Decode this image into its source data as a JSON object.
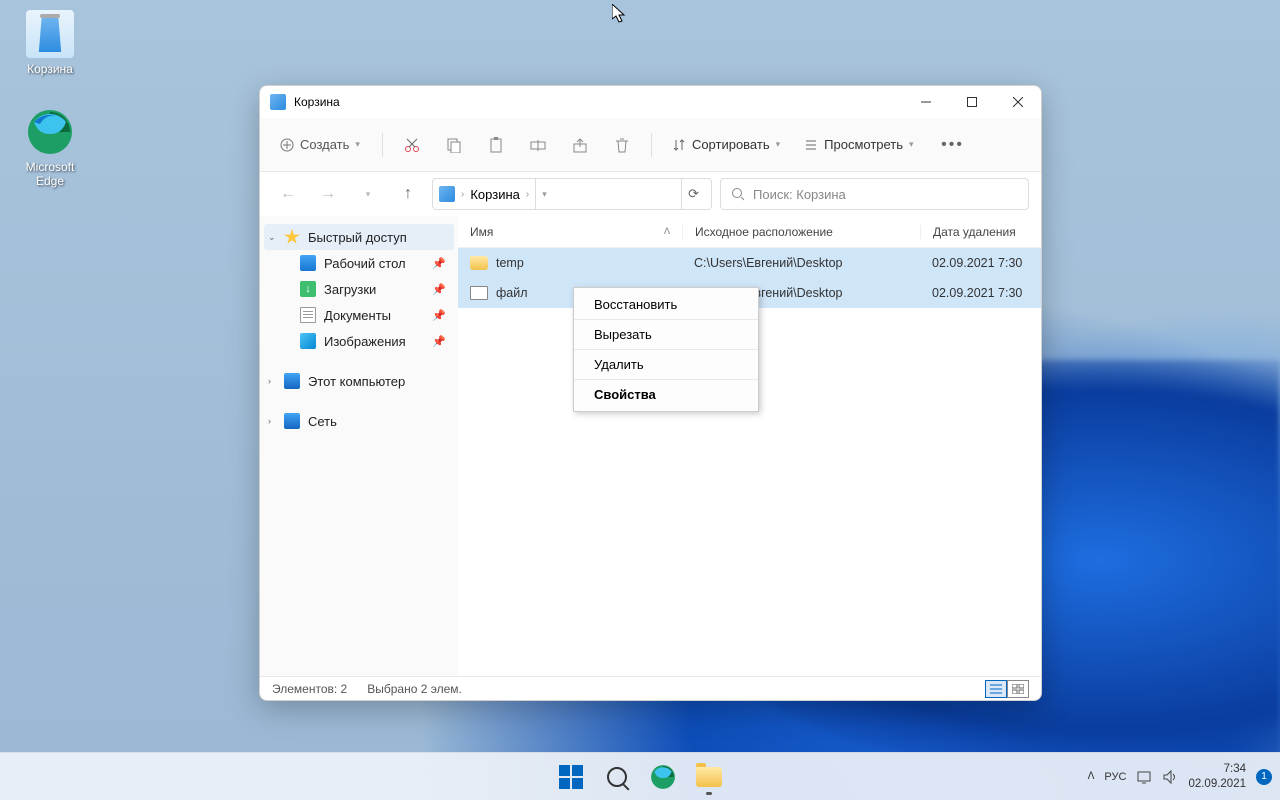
{
  "desktop": {
    "recycle": "Корзина",
    "edge": "Microsoft Edge"
  },
  "window": {
    "title": "Корзина",
    "toolbar": {
      "new": "Создать",
      "sort": "Сортировать",
      "view": "Просмотреть"
    },
    "breadcrumb": "Корзина",
    "search_placeholder": "Поиск: Корзина",
    "sidebar": {
      "quick": "Быстрый доступ",
      "desktop": "Рабочий стол",
      "downloads": "Загрузки",
      "documents": "Документы",
      "pictures": "Изображения",
      "thispc": "Этот компьютер",
      "network": "Сеть"
    },
    "columns": {
      "name": "Имя",
      "location": "Исходное расположение",
      "deleted": "Дата удаления"
    },
    "rows": [
      {
        "name": "temp",
        "type": "folder",
        "location": "C:\\Users\\Евгений\\Desktop",
        "deleted": "02.09.2021 7:30"
      },
      {
        "name": "файл",
        "type": "file",
        "location": "C:\\Users\\Евгений\\Desktop",
        "deleted": "02.09.2021 7:30"
      }
    ],
    "context": {
      "restore": "Восстановить",
      "cut": "Вырезать",
      "delete": "Удалить",
      "properties": "Свойства"
    },
    "status": {
      "count": "Элементов: 2",
      "selected": "Выбрано 2 элем."
    }
  },
  "taskbar": {
    "lang": "РУС",
    "time": "7:34",
    "date": "02.09.2021",
    "badge": "1"
  }
}
